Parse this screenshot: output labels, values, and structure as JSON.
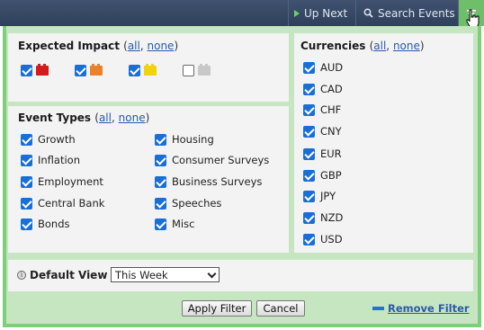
{
  "topbar": {
    "up_next_label": "Up Next",
    "search_events_label": "Search Events"
  },
  "impact": {
    "title": "Expected Impact",
    "all_label": "all",
    "none_label": "none",
    "open_paren": "(",
    "comma": ",",
    "close_paren": ")",
    "levels": [
      {
        "checked": true,
        "color": "#d41b1b"
      },
      {
        "checked": true,
        "color": "#e9822a"
      },
      {
        "checked": true,
        "color": "#f0d20f"
      },
      {
        "checked": false,
        "color": "#c8c8c8"
      }
    ]
  },
  "event_types": {
    "title": "Event Types",
    "all_label": "all",
    "none_label": "none",
    "items": [
      {
        "label": "Growth",
        "checked": true
      },
      {
        "label": "Inflation",
        "checked": true
      },
      {
        "label": "Employment",
        "checked": true
      },
      {
        "label": "Central Bank",
        "checked": true
      },
      {
        "label": "Bonds",
        "checked": true
      },
      {
        "label": "Housing",
        "checked": true
      },
      {
        "label": "Consumer Surveys",
        "checked": true
      },
      {
        "label": "Business Surveys",
        "checked": true
      },
      {
        "label": "Speeches",
        "checked": true
      },
      {
        "label": "Misc",
        "checked": true
      }
    ]
  },
  "currencies": {
    "title": "Currencies",
    "all_label": "all",
    "none_label": "none",
    "items": [
      {
        "label": "AUD",
        "checked": true
      },
      {
        "label": "CAD",
        "checked": true
      },
      {
        "label": "CHF",
        "checked": true
      },
      {
        "label": "CNY",
        "checked": true
      },
      {
        "label": "EUR",
        "checked": true
      },
      {
        "label": "GBP",
        "checked": true
      },
      {
        "label": "JPY",
        "checked": true
      },
      {
        "label": "NZD",
        "checked": true
      },
      {
        "label": "USD",
        "checked": true
      }
    ]
  },
  "default_view": {
    "label": "Default View",
    "selected": "This Week"
  },
  "actions": {
    "apply_label": "Apply Filter",
    "cancel_label": "Cancel",
    "remove_label": "Remove Filter"
  },
  "colors": {
    "topbar": "#33445f",
    "panel_border": "#7fcf7a",
    "panel_bg": "#c6e6c2",
    "checkbox": "#1a6fd6",
    "link": "#2a5aa8"
  }
}
